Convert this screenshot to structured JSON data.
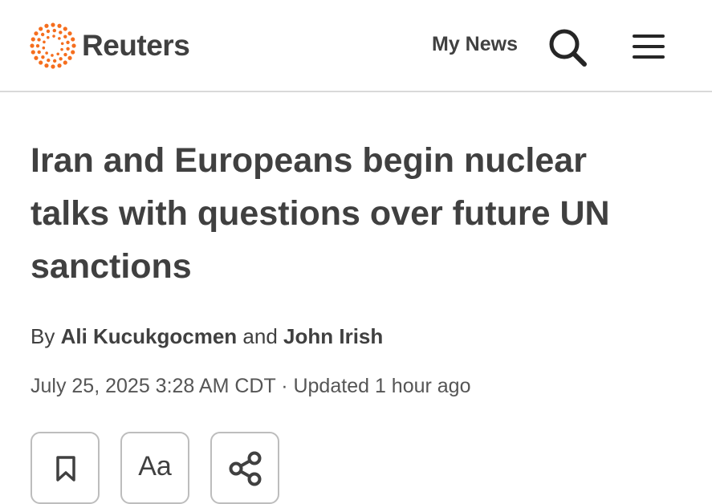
{
  "header": {
    "brand": "Reuters",
    "my_news": "My News",
    "brand_color": "#f56e1e"
  },
  "article": {
    "headline": "Iran and Europeans begin nuclear talks with questions over future UN sanctions",
    "byline": {
      "prefix": "By",
      "author1": "Ali Kucukgocmen",
      "conjunction": "and",
      "author2": "John Irish"
    },
    "dateline": "July 25, 2025 3:28 AM CDT · Updated 1 hour ago"
  },
  "actions": {
    "text_size_label": "Aa",
    "icons": [
      "bookmark-icon",
      "text-size-icon",
      "share-icon"
    ]
  }
}
